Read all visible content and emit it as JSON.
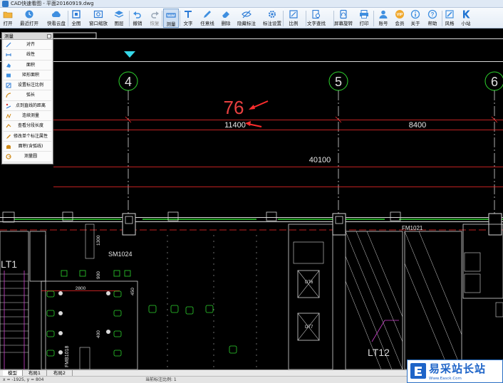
{
  "window": {
    "title": "CAD快速看图 - 平面20160919.dwg"
  },
  "toolbar": {
    "items": [
      {
        "label": "打开",
        "icon": "folder-open-icon"
      },
      {
        "label": "最近打开",
        "icon": "clock-icon"
      },
      {
        "label": "快看云盘",
        "icon": "cloud-icon"
      },
      {
        "label": "全图",
        "icon": "fit-all-icon"
      },
      {
        "label": "窗口缩放",
        "icon": "window-zoom-icon"
      },
      {
        "label": "图层",
        "icon": "layers-icon"
      },
      {
        "label": "撤销",
        "icon": "undo-icon"
      },
      {
        "label": "恢复",
        "icon": "redo-icon"
      },
      {
        "label": "测量",
        "icon": "measure-ruler-icon"
      },
      {
        "label": "文字",
        "icon": "text-icon"
      },
      {
        "label": "任意线",
        "icon": "pen-icon"
      },
      {
        "label": "删除",
        "icon": "eraser-icon"
      },
      {
        "label": "隐藏标注",
        "icon": "eye-hide-icon"
      },
      {
        "label": "标注设置",
        "icon": "annotation-settings-icon"
      },
      {
        "label": "比例",
        "icon": "scale-icon"
      },
      {
        "label": "文字查找",
        "icon": "text-search-icon"
      },
      {
        "label": "屏幕旋转",
        "icon": "rotate-screen-icon"
      },
      {
        "label": "打印",
        "icon": "printer-icon"
      },
      {
        "label": "账号",
        "icon": "user-icon"
      },
      {
        "label": "会员",
        "icon": "vip-icon"
      },
      {
        "label": "关于",
        "icon": "info-icon"
      },
      {
        "label": "帮助",
        "icon": "help-icon"
      },
      {
        "label": "风格",
        "icon": "brush-icon"
      },
      {
        "label": "小站",
        "icon": "k-logo-icon"
      }
    ],
    "disabled_items": [
      "恢复"
    ],
    "active_item": "测量"
  },
  "measure_panel": {
    "title": "测量",
    "items": [
      {
        "label": "对齐",
        "icon": "align-icon"
      },
      {
        "label": "线性",
        "icon": "linear-icon"
      },
      {
        "label": "面积",
        "icon": "area-icon"
      },
      {
        "label": "矩形面积",
        "icon": "rect-area-icon"
      },
      {
        "label": "设置标注比例",
        "icon": "scale-setting-icon"
      },
      {
        "label": "弧长",
        "icon": "arc-icon"
      },
      {
        "label": "点到直线的距离",
        "icon": "point-line-icon"
      },
      {
        "label": "连续测量",
        "icon": "continuous-icon"
      },
      {
        "label": "查看分段长度",
        "icon": "segment-icon"
      },
      {
        "label": "修改单个标注属性",
        "icon": "edit-annotation-icon"
      },
      {
        "label": "面积(含弧线)",
        "icon": "arc-area-icon"
      },
      {
        "label": "测量圆",
        "icon": "circle-measure-icon"
      }
    ]
  },
  "drawing": {
    "axis_labels": [
      "4",
      "5",
      "6"
    ],
    "dimensions": [
      "76",
      "11400",
      "8400",
      "40100"
    ],
    "room_labels": [
      "LT1",
      "SM1024",
      "FM1021",
      "LT12",
      "FMB1018",
      "DT6",
      "DT7"
    ],
    "small_dims": [
      "2800",
      "1300",
      "900",
      "450",
      "400"
    ]
  },
  "tabs": [
    {
      "label": "模型",
      "active": true
    },
    {
      "label": "布局1",
      "active": false
    },
    {
      "label": "布局2",
      "active": false
    }
  ],
  "status": {
    "coords": "x = -1925, y = 804",
    "scale_label": "当前标注比例: 1"
  },
  "watermark": {
    "main": "易采站长站",
    "url": "Www.Easck.Com"
  },
  "colors": {
    "axis": "#e0e0e0",
    "red_lines": "#ff2d2d",
    "green": "#2ed52e",
    "cyan": "#36d8e8",
    "magenta": "#d040d0",
    "dim_text": "#e8e8e8",
    "annotation_red": "#e84040"
  }
}
